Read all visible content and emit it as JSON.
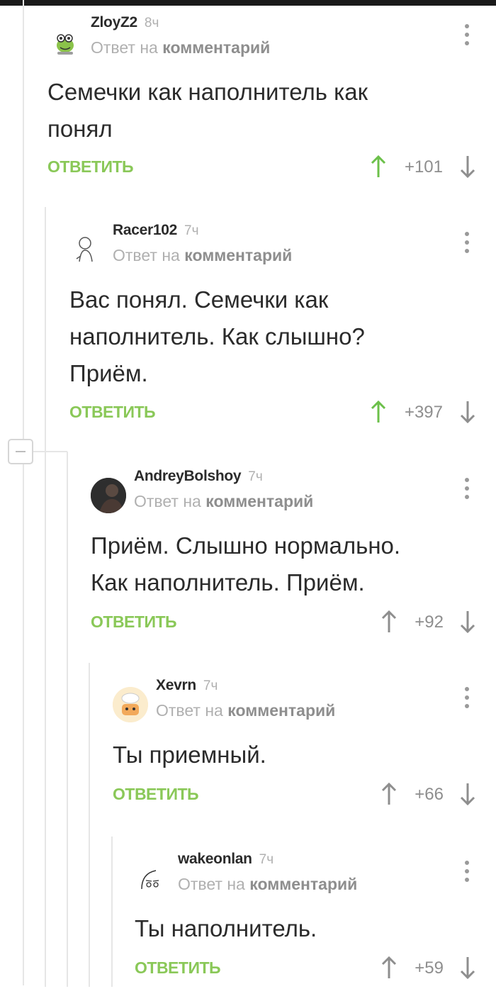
{
  "reply_prefix": "Ответ на",
  "reply_target": "комментарий",
  "comments": [
    {
      "user": "ZloyZ2",
      "time": "8ч",
      "text": "Семечки как наполнитель как\nпонял",
      "reply": "ОТВЕТИТЬ",
      "score": "+101",
      "upvoted": true,
      "avatar_icon": "frog-icon"
    },
    {
      "user": "Racer102",
      "time": "7ч",
      "text": "Вас понял. Семечки как\nнаполнитель. Как слышно?\nПриём.",
      "reply": "ОТВЕТИТЬ",
      "score": "+397",
      "upvoted": true,
      "avatar_icon": "sketch-person-icon"
    },
    {
      "user": "AndreyBolshoy",
      "time": "7ч",
      "text": "Приём. Слышно нормально.\nКак наполнитель. Приём.",
      "reply": "ОТВЕТИТЬ",
      "score": "+92",
      "upvoted": false,
      "avatar_icon": "photo-avatar"
    },
    {
      "user": "Xevrn",
      "time": "7ч",
      "text": "Ты приемный.",
      "reply": "ОТВЕТИТЬ",
      "score": "+66",
      "upvoted": false,
      "avatar_icon": "cartoon-face-icon"
    },
    {
      "user": "wakeonlan",
      "time": "7ч",
      "text": "Ты наполнитель.",
      "reply": "ОТВЕТИТЬ",
      "score": "+59",
      "upvoted": false,
      "avatar_icon": "doodle-face-icon"
    }
  ],
  "colors": {
    "accent_green": "#8ac858",
    "upvote_active": "#6cc04a",
    "muted": "#8e8e8e",
    "thread_line": "#e6e6e6"
  }
}
